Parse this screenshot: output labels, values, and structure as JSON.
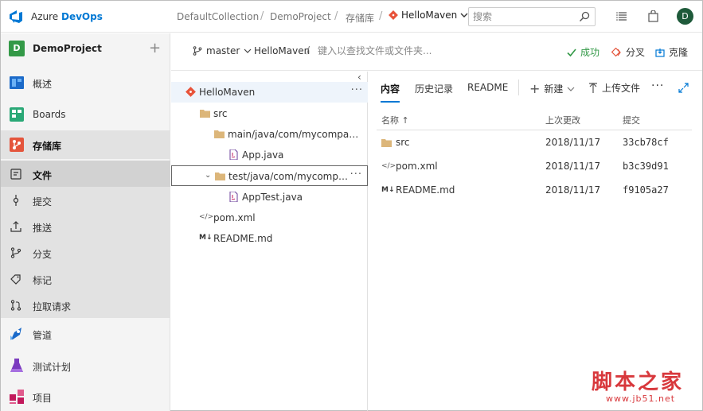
{
  "topbar": {
    "brand_part1": "Azure",
    "brand_part2": "DevOps",
    "breadcrumbs": [
      "DefaultCollection",
      "DemoProject",
      "存储库"
    ],
    "repo": "HelloMaven",
    "search_placeholder": "搜索",
    "avatar_initial": "D"
  },
  "nav": {
    "project_initial": "D",
    "project_name": "DemoProject",
    "items": [
      {
        "label": "概述",
        "icon": "overview-icon"
      },
      {
        "label": "Boards",
        "icon": "boards-icon"
      },
      {
        "label": "存储库",
        "icon": "repos-icon"
      },
      {
        "label": "管道",
        "icon": "pipelines-icon"
      },
      {
        "label": "测试计划",
        "icon": "test-plans-icon"
      },
      {
        "label": "项目",
        "icon": "artifacts-icon"
      }
    ],
    "repo_sub": [
      {
        "label": "文件",
        "icon": "files-icon"
      },
      {
        "label": "提交",
        "icon": "commits-icon"
      },
      {
        "label": "推送",
        "icon": "pushes-icon"
      },
      {
        "label": "分支",
        "icon": "branches-icon"
      },
      {
        "label": "标记",
        "icon": "tags-icon"
      },
      {
        "label": "拉取请求",
        "icon": "pull-requests-icon"
      }
    ]
  },
  "subheader": {
    "branch": "master",
    "path_root": "HelloMaven",
    "path_sep": "/",
    "path_placeholder": "键入以查找文件或文件夹...",
    "status": "成功",
    "fork": "分叉",
    "clone": "克隆"
  },
  "tree": {
    "nodes": [
      {
        "label": "HelloMaven",
        "type": "repo"
      },
      {
        "label": "src",
        "type": "folder"
      },
      {
        "label": "main/java/com/mycompany/hell...",
        "type": "folder"
      },
      {
        "label": "App.java",
        "type": "java"
      },
      {
        "label": "test/java/com/mycompany/...",
        "type": "folder"
      },
      {
        "label": "AppTest.java",
        "type": "java"
      },
      {
        "label": "pom.xml",
        "type": "xml"
      },
      {
        "label": "README.md",
        "type": "md"
      }
    ],
    "more": "···"
  },
  "tabs": {
    "items": [
      "内容",
      "历史记录",
      "README"
    ],
    "new_label": "新建",
    "upload_label": "上传文件",
    "more": "···"
  },
  "files": {
    "columns": {
      "name": "名称 ↑",
      "modified": "上次更改",
      "commit": "提交"
    },
    "rows": [
      {
        "name": "src",
        "type": "folder",
        "date": "2018/11/17",
        "commit": "33cb78cf"
      },
      {
        "name": "pom.xml",
        "type": "xml",
        "date": "2018/11/17",
        "commit": "b3c39d91"
      },
      {
        "name": "README.md",
        "type": "md",
        "date": "2018/11/17",
        "commit": "f9105a27"
      }
    ]
  },
  "watermark": {
    "title": "脚本之家",
    "url": "www.jb51.net"
  },
  "colors": {
    "accent": "#0078d4",
    "success": "#339947",
    "repo_icon": "#e8533a",
    "folder": "#dcb67a"
  }
}
